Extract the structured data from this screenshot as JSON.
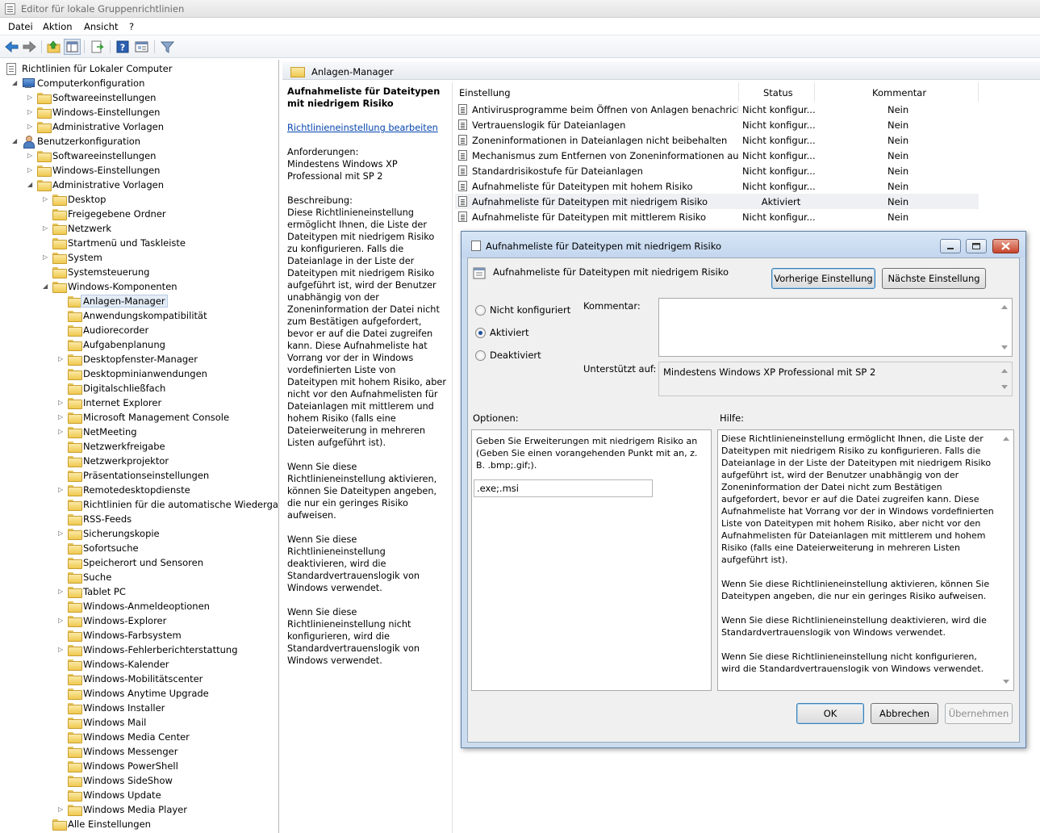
{
  "window": {
    "title": "Editor für lokale Gruppenrichtlinien"
  },
  "menu": [
    "Datei",
    "Aktion",
    "Ansicht",
    "?"
  ],
  "toolbar": {
    "icons": [
      "back-arrow-icon",
      "forward-arrow-icon",
      "folder-up-icon",
      "show-hide-tree-icon",
      "export-list-icon",
      "help-icon",
      "properties-view-icon",
      "filter-icon"
    ]
  },
  "tree": {
    "root": "Richtlinien für Lokaler Computer",
    "computer": "Computerkonfiguration",
    "computer_children": [
      "Softwareeinstellungen",
      "Windows-Einstellungen",
      "Administrative Vorlagen"
    ],
    "user": "Benutzerkonfiguration",
    "user_children": [
      "Softwareeinstellungen",
      "Windows-Einstellungen",
      "Administrative Vorlagen"
    ],
    "admin_children": [
      "Desktop",
      "Freigegebene Ordner",
      "Netzwerk",
      "Startmenü und Taskleiste",
      "System",
      "Systemsteuerung",
      "Windows-Komponenten"
    ],
    "components": [
      "Anlagen-Manager",
      "Anwendungskompatibilität",
      "Audiorecorder",
      "Aufgabenplanung",
      "Desktopfenster-Manager",
      "Desktopminianwendungen",
      "Digitalschließfach",
      "Internet Explorer",
      "Microsoft Management Console",
      "NetMeeting",
      "Netzwerkfreigabe",
      "Netzwerkprojektor",
      "Präsentationseinstellungen",
      "Remotedesktopdienste",
      "Richtlinien für die automatische Wiedergabe",
      "RSS-Feeds",
      "Sicherungskopie",
      "Sofortsuche",
      "Speicherort und Sensoren",
      "Suche",
      "Tablet PC",
      "Windows-Anmeldeoptionen",
      "Windows-Explorer",
      "Windows-Farbsystem",
      "Windows-Fehlerberichterstattung",
      "Windows-Kalender",
      "Windows-Mobilitätscenter",
      "Windows Anytime Upgrade",
      "Windows Installer",
      "Windows Mail",
      "Windows Media Center",
      "Windows Messenger",
      "Windows PowerShell",
      "Windows SideShow",
      "Windows Update",
      "Windows Media Player"
    ],
    "all_settings": "Alle Einstellungen",
    "selected": "Anlagen-Manager"
  },
  "middle": {
    "header": "Anlagen-Manager",
    "desc": {
      "title": "Aufnahmeliste für Dateitypen mit niedrigem Risiko",
      "edit_link": "Richtlinieneinstellung bearbeiten",
      "req_label": "Anforderungen:",
      "req_value": "Mindestens Windows XP Professional mit SP 2",
      "desc_label": "Beschreibung:",
      "p1": "Diese Richtlinieneinstellung ermöglicht Ihnen, die Liste der Dateitypen mit niedrigem Risiko zu konfigurieren. Falls die Dateianlage in der Liste der Dateitypen mit niedrigem Risiko aufgeführt ist, wird der Benutzer unabhängig von der Zoneninformation der Datei nicht zum Bestätigen aufgefordert, bevor er auf die Datei zugreifen kann. Diese Aufnahmeliste hat Vorrang vor der in Windows vordefinierten Liste von Dateitypen mit hohem Risiko, aber nicht vor den Aufnahmelisten für Dateianlagen mit mittlerem und hohem Risiko (falls eine Dateierweiterung in mehreren Listen aufgeführt ist).",
      "p2": "Wenn Sie diese Richtlinieneinstellung aktivieren, können Sie Dateitypen angeben, die nur ein geringes Risiko aufweisen.",
      "p3": "Wenn Sie diese Richtlinieneinstellung deaktivieren, wird die Standardvertrauenslogik von Windows verwendet.",
      "p4": "Wenn Sie diese Richtlinieneinstellung nicht konfigurieren, wird die Standardvertrauenslogik von Windows verwendet."
    },
    "columns": [
      "Einstellung",
      "Status",
      "Kommentar"
    ],
    "rows": [
      {
        "name": "Antivirusprogramme beim Öffnen von Anlagen benachricht...",
        "status": "Nicht konfigur...",
        "comment": "Nein"
      },
      {
        "name": "Vertrauenslogik für Dateianlagen",
        "status": "Nicht konfigur...",
        "comment": "Nein"
      },
      {
        "name": "Zoneninformationen in Dateianlagen nicht beibehalten",
        "status": "Nicht konfigur...",
        "comment": "Nein"
      },
      {
        "name": "Mechanismus zum Entfernen von Zoneninformationen aus...",
        "status": "Nicht konfigur...",
        "comment": "Nein"
      },
      {
        "name": "Standardrisikostufe für Dateianlagen",
        "status": "Nicht konfigur...",
        "comment": "Nein"
      },
      {
        "name": "Aufnahmeliste für Dateitypen mit hohem Risiko",
        "status": "Nicht konfigur...",
        "comment": "Nein"
      },
      {
        "name": "Aufnahmeliste für Dateitypen mit niedrigem Risiko",
        "status": "Aktiviert",
        "comment": "Nein"
      },
      {
        "name": "Aufnahmeliste für Dateitypen mit mittlerem Risiko",
        "status": "Nicht konfigur...",
        "comment": "Nein"
      }
    ],
    "selected_row": 6
  },
  "dialog": {
    "title": "Aufnahmeliste für Dateitypen mit niedrigem Risiko",
    "heading": "Aufnahmeliste für Dateitypen mit niedrigem Risiko",
    "prev_button": "Vorherige Einstellung",
    "next_button": "Nächste Einstellung",
    "radio_not_configured": "Nicht konfiguriert",
    "radio_enabled": "Aktiviert",
    "radio_disabled": "Deaktiviert",
    "selected_radio": "Aktiviert",
    "comment_label": "Kommentar:",
    "comment_value": "",
    "supported_label": "Unterstützt auf:",
    "supported_value": "Mindestens Windows XP Professional mit SP 2",
    "options_label": "Optionen:",
    "help_label": "Hilfe:",
    "option_prompt": "Geben Sie Erweiterungen mit niedrigem Risiko an (Geben Sie einen vorangehenden Punkt mit an, z. B. .bmp;.gif;).",
    "option_value": ".exe;.msi",
    "help_p1": "Diese Richtlinieneinstellung ermöglicht Ihnen, die Liste der Dateitypen mit niedrigem Risiko zu konfigurieren. Falls die Dateianlage in der Liste der Dateitypen mit niedrigem Risiko aufgeführt ist, wird der Benutzer unabhängig von der Zoneninformation der Datei nicht zum Bestätigen aufgefordert, bevor er auf die Datei zugreifen kann. Diese Aufnahmeliste hat Vorrang vor der in Windows vordefinierten Liste von Dateitypen mit hohem Risiko, aber nicht vor den Aufnahmelisten für Dateianlagen mit mittlerem und hohem Risiko (falls eine Dateierweiterung in mehreren Listen aufgeführt ist).",
    "help_p2": "Wenn Sie diese Richtlinieneinstellung aktivieren, können Sie Dateitypen angeben, die nur ein geringes Risiko aufweisen.",
    "help_p3": "Wenn Sie diese Richtlinieneinstellung deaktivieren, wird die Standardvertrauenslogik von Windows verwendet.",
    "help_p4": "Wenn Sie diese Richtlinieneinstellung nicht konfigurieren, wird die Standardvertrauenslogik von Windows verwendet.",
    "ok": "OK",
    "cancel": "Abbrechen",
    "apply": "Übernehmen"
  }
}
